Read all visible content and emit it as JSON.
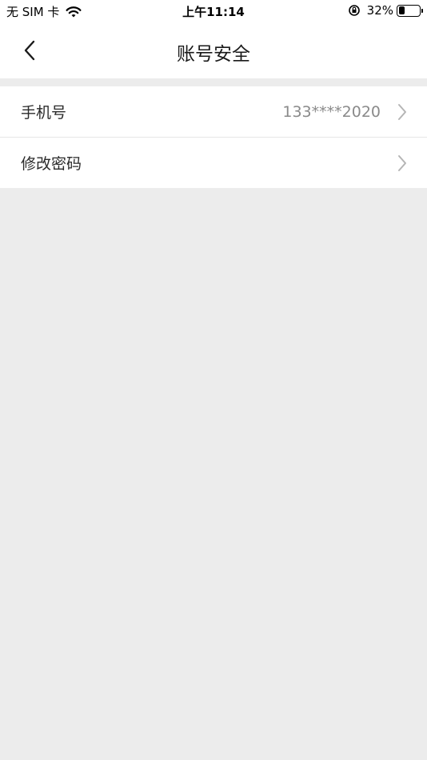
{
  "status_bar": {
    "carrier": "无 SIM 卡",
    "time": "上午11:14",
    "battery_percent": "32%",
    "battery_level": 0.32
  },
  "nav": {
    "title": "账号安全",
    "back_icon": "chevron-left-icon"
  },
  "settings": {
    "items": [
      {
        "label": "手机号",
        "value": "133****2020",
        "icon": "chevron-right-icon"
      },
      {
        "label": "修改密码",
        "value": "",
        "icon": "chevron-right-icon"
      }
    ]
  },
  "colors": {
    "background": "#ececec",
    "surface": "#ffffff",
    "divider": "#e6e6e6",
    "secondary_text": "#8a8a8a"
  }
}
